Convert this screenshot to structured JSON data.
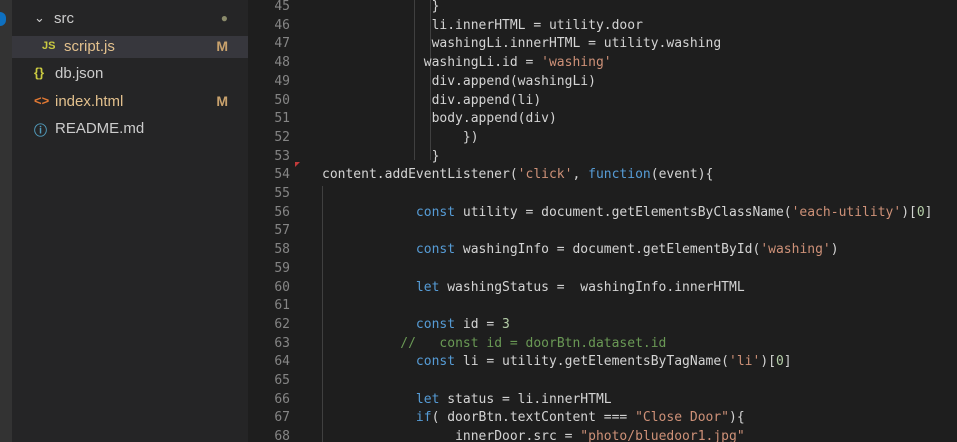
{
  "explorer": {
    "items": [
      {
        "label": "src",
        "kind": "folder",
        "indent": 1,
        "badge": "●",
        "badge_kind": "dot"
      },
      {
        "label": "script.js",
        "kind": "js",
        "icon": "JS",
        "indent": 2,
        "badge": "M",
        "selected": true
      },
      {
        "label": "db.json",
        "kind": "json",
        "icon": "{}",
        "indent": 1,
        "badge": ""
      },
      {
        "label": "index.html",
        "kind": "html",
        "icon": "<>",
        "indent": 1,
        "badge": "M"
      },
      {
        "label": "README.md",
        "kind": "info",
        "icon": "ⓘ",
        "indent": 1,
        "badge": ""
      }
    ],
    "colors": {
      "js": "#cbcb41",
      "json": "#cbcb41",
      "html": "#e37933",
      "info": "#519aba",
      "modified": "#e2c08d"
    }
  },
  "editor": {
    "lines": [
      {
        "n": "45",
        "indent": "              ",
        "tokens": [
          {
            "t": "}",
            "c": ""
          }
        ]
      },
      {
        "n": "46",
        "indent": "              ",
        "tokens": [
          {
            "t": "li.innerHTML = utility.door",
            "c": ""
          }
        ]
      },
      {
        "n": "47",
        "indent": "              ",
        "tokens": [
          {
            "t": "washingLi.innerHTML = utility.washing",
            "c": ""
          }
        ]
      },
      {
        "n": "48",
        "indent": "             ",
        "tokens": [
          {
            "t": "washingLi.id = ",
            "c": ""
          },
          {
            "t": "'washing'",
            "c": "str"
          }
        ]
      },
      {
        "n": "49",
        "indent": "              ",
        "tokens": [
          {
            "t": "div.append(washingLi)",
            "c": ""
          }
        ]
      },
      {
        "n": "50",
        "indent": "              ",
        "tokens": [
          {
            "t": "div.append(li)",
            "c": ""
          }
        ]
      },
      {
        "n": "51",
        "indent": "              ",
        "tokens": [
          {
            "t": "body.append(div)",
            "c": ""
          }
        ]
      },
      {
        "n": "52",
        "indent": "                  ",
        "tokens": [
          {
            "t": "})",
            "c": ""
          }
        ]
      },
      {
        "n": "53",
        "indent": "              ",
        "tokens": [
          {
            "t": "}",
            "c": ""
          }
        ]
      },
      {
        "n": "54",
        "indent": "",
        "tokens": [
          {
            "t": "content.addEventListener(",
            "c": ""
          },
          {
            "t": "'click'",
            "c": "str"
          },
          {
            "t": ", ",
            "c": ""
          },
          {
            "t": "function",
            "c": "kw"
          },
          {
            "t": "(event){",
            "c": ""
          }
        ]
      },
      {
        "n": "55",
        "indent": "",
        "tokens": []
      },
      {
        "n": "56",
        "indent": "            ",
        "tokens": [
          {
            "t": "const",
            "c": "kw"
          },
          {
            "t": " utility = document.getElementsByClassName(",
            "c": ""
          },
          {
            "t": "'each-utility'",
            "c": "str"
          },
          {
            "t": ")[",
            "c": ""
          },
          {
            "t": "0",
            "c": "num"
          },
          {
            "t": "]",
            "c": ""
          }
        ]
      },
      {
        "n": "57",
        "indent": "",
        "tokens": []
      },
      {
        "n": "58",
        "indent": "            ",
        "tokens": [
          {
            "t": "const",
            "c": "kw"
          },
          {
            "t": " washingInfo = document.getElementById(",
            "c": ""
          },
          {
            "t": "'washing'",
            "c": "str"
          },
          {
            "t": ")",
            "c": ""
          }
        ]
      },
      {
        "n": "59",
        "indent": "",
        "tokens": []
      },
      {
        "n": "60",
        "indent": "            ",
        "tokens": [
          {
            "t": "let",
            "c": "kw"
          },
          {
            "t": " washingStatus =  washingInfo.innerHTML",
            "c": ""
          }
        ]
      },
      {
        "n": "61",
        "indent": "",
        "tokens": []
      },
      {
        "n": "62",
        "indent": "            ",
        "tokens": [
          {
            "t": "const",
            "c": "kw"
          },
          {
            "t": " id = ",
            "c": ""
          },
          {
            "t": "3",
            "c": "num"
          }
        ]
      },
      {
        "n": "63",
        "indent": "          ",
        "tokens": [
          {
            "t": "//   const id = doorBtn.dataset.id",
            "c": "cm"
          }
        ]
      },
      {
        "n": "64",
        "indent": "            ",
        "tokens": [
          {
            "t": "const",
            "c": "kw"
          },
          {
            "t": " li = utility.getElementsByTagName(",
            "c": ""
          },
          {
            "t": "'li'",
            "c": "str"
          },
          {
            "t": ")[",
            "c": ""
          },
          {
            "t": "0",
            "c": "num"
          },
          {
            "t": "]",
            "c": ""
          }
        ]
      },
      {
        "n": "65",
        "indent": "",
        "tokens": []
      },
      {
        "n": "66",
        "indent": "            ",
        "tokens": [
          {
            "t": "let",
            "c": "kw"
          },
          {
            "t": " status = li.innerHTML",
            "c": ""
          }
        ]
      },
      {
        "n": "67",
        "indent": "            ",
        "tokens": [
          {
            "t": "if",
            "c": "kw"
          },
          {
            "t": "( doorBtn.textContent === ",
            "c": ""
          },
          {
            "t": "\"Close Door\"",
            "c": "str"
          },
          {
            "t": "){",
            "c": ""
          }
        ]
      },
      {
        "n": "68",
        "indent": "                 ",
        "tokens": [
          {
            "t": "innerDoor.src = ",
            "c": ""
          },
          {
            "t": "\"photo/bluedoor1.jpg\"",
            "c": "str"
          }
        ]
      }
    ]
  }
}
